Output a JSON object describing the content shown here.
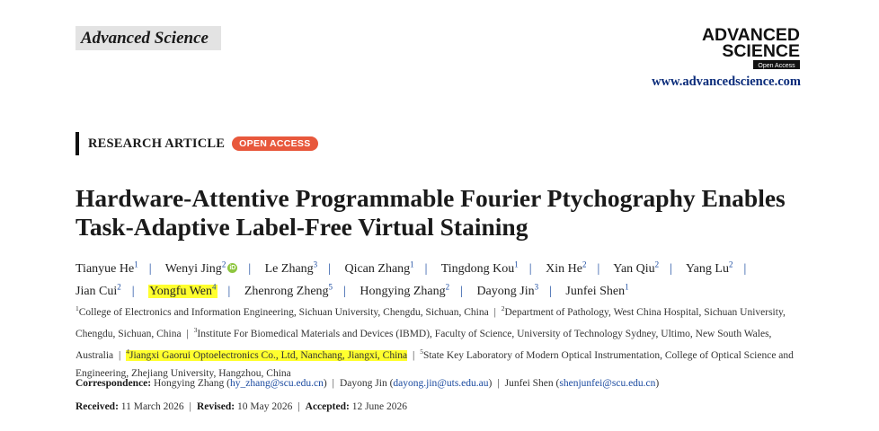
{
  "journal": {
    "name": "Advanced Science",
    "logo_line1": "ADVANCED",
    "logo_line2": "SCIENCE",
    "logo_tag": "Open Access",
    "url": "www.advancedscience.com"
  },
  "article": {
    "type": "RESEARCH ARTICLE",
    "access": "OPEN ACCESS",
    "title": "Hardware-Attentive Programmable Fourier Ptychography Enables Task-Adaptive Label-Free Virtual Staining"
  },
  "authors": [
    {
      "name": "Tianyue He",
      "aff": "1"
    },
    {
      "name": "Wenyi Jing",
      "aff": "2",
      "orcid": true
    },
    {
      "name": "Le Zhang",
      "aff": "3"
    },
    {
      "name": "Qican Zhang",
      "aff": "1"
    },
    {
      "name": "Tingdong Kou",
      "aff": "1"
    },
    {
      "name": "Xin He",
      "aff": "2"
    },
    {
      "name": "Yan Qiu",
      "aff": "2"
    },
    {
      "name": "Yang Lu",
      "aff": "2"
    },
    {
      "name": "Jian Cui",
      "aff": "2"
    },
    {
      "name": "Yongfu Wen",
      "aff": "4",
      "highlight": true
    },
    {
      "name": "Zhenrong Zheng",
      "aff": "5"
    },
    {
      "name": "Hongying Zhang",
      "aff": "2"
    },
    {
      "name": "Dayong Jin",
      "aff": "3"
    },
    {
      "name": "Junfei Shen",
      "aff": "1"
    }
  ],
  "orcid_glyph": "iD",
  "affiliations": [
    {
      "num": "1",
      "text": "College of Electronics and Information Engineering, Sichuan University, Chengdu, Sichuan, China"
    },
    {
      "num": "2",
      "text": "Department of Pathology, West China Hospital, Sichuan University, Chengdu, Sichuan, China"
    },
    {
      "num": "3",
      "text": "Institute For Biomedical Materials and Devices (IBMD), Faculty of Science, University of Technology Sydney, Ultimo, New South Wales, Australia"
    },
    {
      "num": "4",
      "text": "Jiangxi Gaorui Optoelectronics Co., Ltd, Nanchang, Jiangxi, China",
      "highlight": true
    },
    {
      "num": "5",
      "text": "State Key Laboratory of Modern Optical Instrumentation, College of Optical Science and Engineering, Zhejiang University, Hangzhou, China"
    }
  ],
  "correspondence": {
    "label": "Correspondence:",
    "items": [
      {
        "name": "Hongying Zhang",
        "email": "hy_zhang@scu.edu.cn"
      },
      {
        "name": "Dayong Jin",
        "email": "dayong.jin@uts.edu.au"
      },
      {
        "name": "Junfei Shen",
        "email": "shenjunfei@scu.edu.cn"
      }
    ]
  },
  "dates": [
    {
      "label": "Received:",
      "value": "11 March 2026"
    },
    {
      "label": "Revised:",
      "value": "10 May 2026"
    },
    {
      "label": "Accepted:",
      "value": "12 June 2026"
    }
  ]
}
